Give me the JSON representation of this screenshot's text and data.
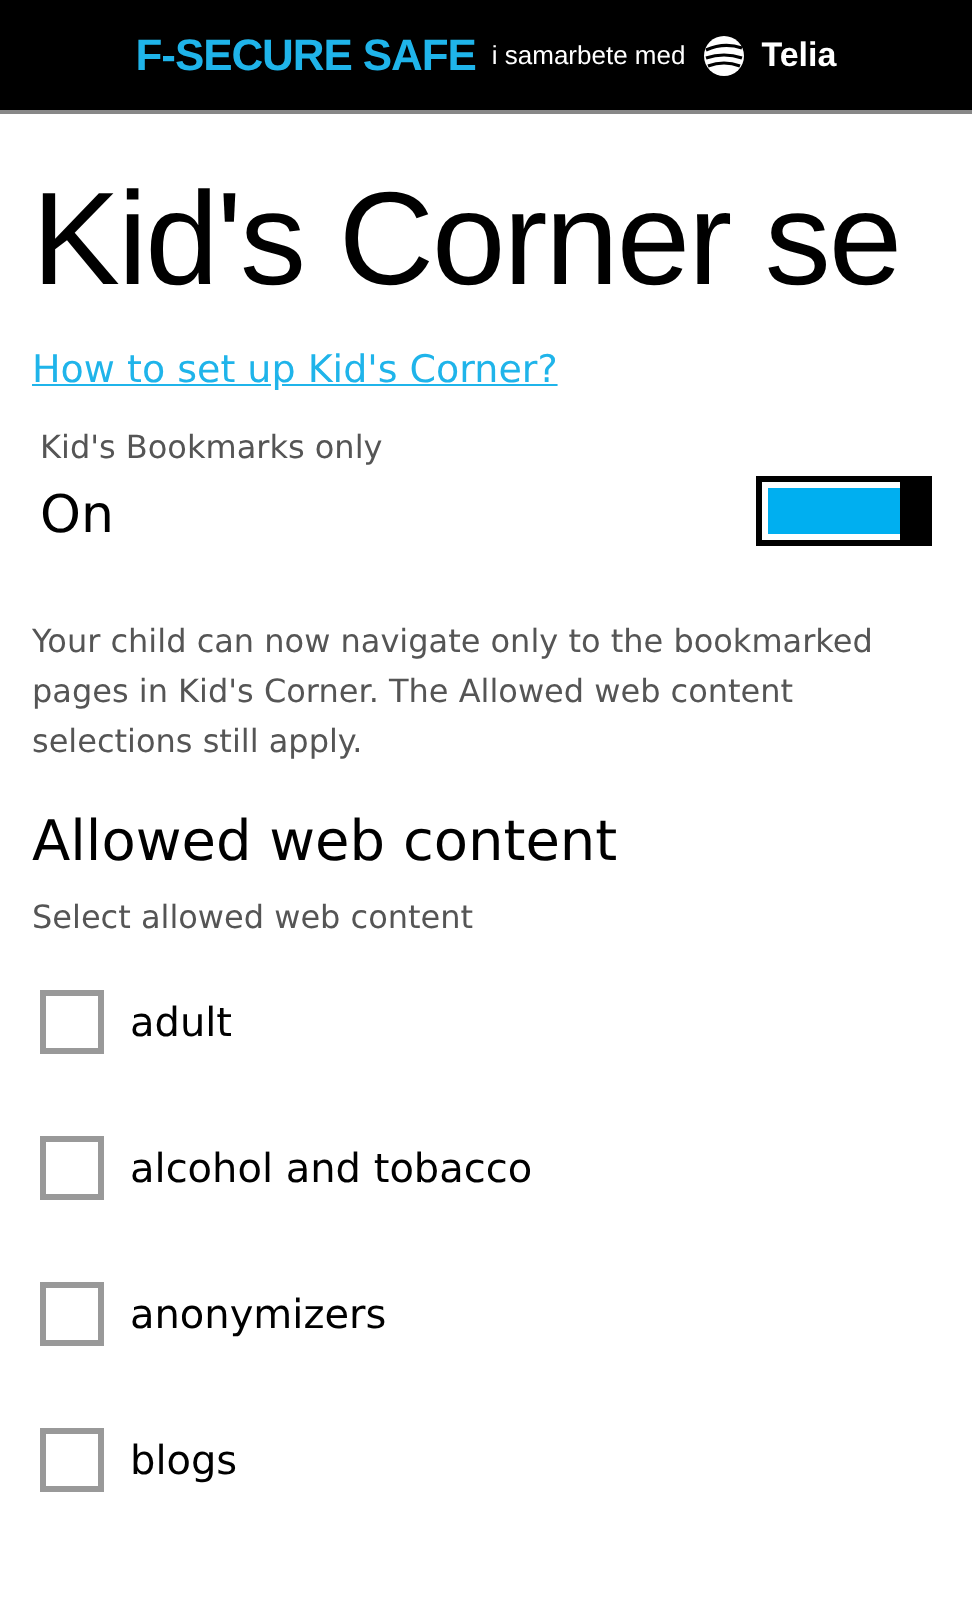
{
  "banner": {
    "brand": "F-SECURE SAFE",
    "partner_text": "i samarbete med",
    "partner": "Telia"
  },
  "title": "Kid's Corner se",
  "help_link": "How to set up Kid's Corner?",
  "bookmarks_toggle": {
    "label": "Kid's Bookmarks only",
    "value": "On",
    "on": true
  },
  "description": "Your child can now navigate only to the bookmarked pages in Kid's Corner. The Allowed web content selections still apply.",
  "content_section": {
    "heading": "Allowed web content",
    "subtitle": "Select allowed web content",
    "items": [
      {
        "label": "adult",
        "checked": false
      },
      {
        "label": "alcohol and tobacco",
        "checked": false
      },
      {
        "label": "anonymizers",
        "checked": false
      },
      {
        "label": "blogs",
        "checked": false
      }
    ]
  }
}
